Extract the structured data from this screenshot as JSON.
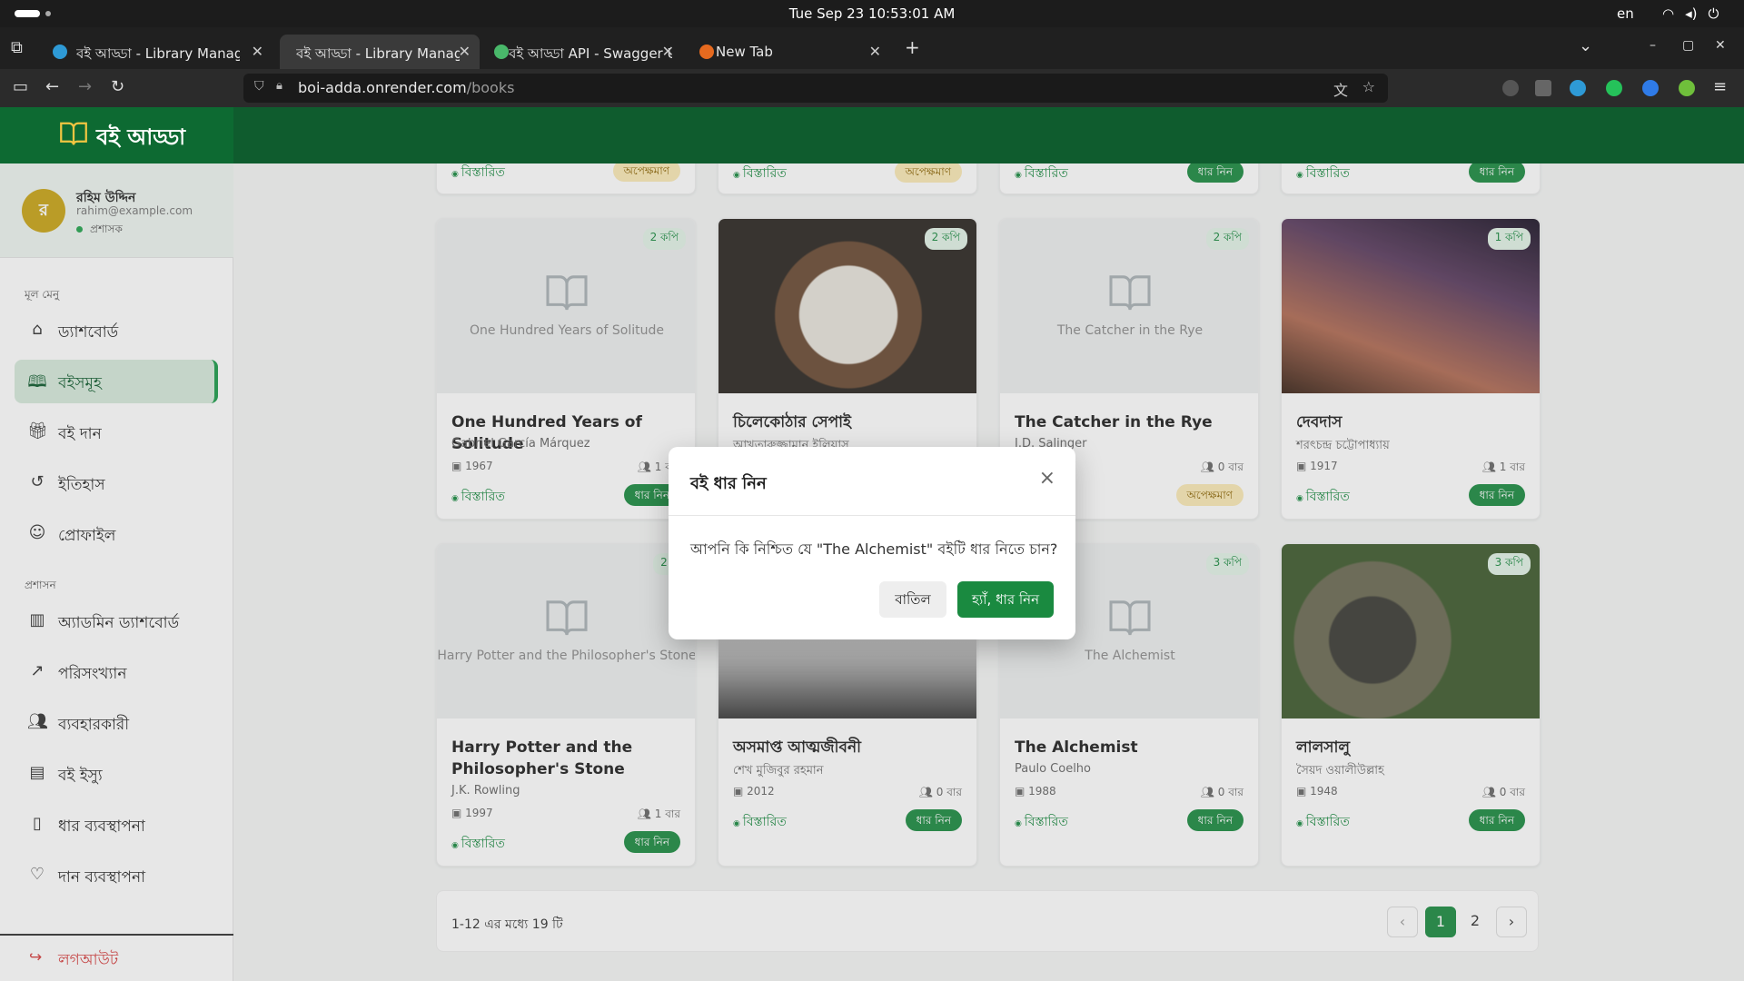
{
  "system": {
    "datetime": "Tue Sep 23  10:53:01 AM",
    "lang": "en"
  },
  "browser": {
    "tabs": [
      {
        "label": "বই আড্ডা - Library Manageme"
      },
      {
        "label": "বই আড্ডা - Library Manageme"
      },
      {
        "label": "বই আড্ডা API - Swagger UI"
      },
      {
        "label": "New Tab"
      }
    ],
    "url_host": "boi-adda.onrender.com",
    "url_path": "/books"
  },
  "app": {
    "brand": "বই আড্ডা"
  },
  "user": {
    "initial": "র",
    "name": "রহিম উদ্দিন",
    "email": "rahim@example.com",
    "role": "প্রশাসক"
  },
  "sidebar": {
    "main_section": "মূল মেনু",
    "admin_section": "প্রশাসন",
    "main_items": [
      {
        "label": "ড্যাশবোর্ড",
        "icon": "home-icon"
      },
      {
        "label": "বইসমূহ",
        "icon": "book-icon"
      },
      {
        "label": "বই দান",
        "icon": "gift-icon"
      },
      {
        "label": "ইতিহাস",
        "icon": "history-icon"
      },
      {
        "label": "প্রোফাইল",
        "icon": "user-icon"
      }
    ],
    "admin_items": [
      {
        "label": "অ্যাডমিন ড্যাশবোর্ড",
        "icon": "bar-chart-icon"
      },
      {
        "label": "পরিসংখ্যান",
        "icon": "trend-icon"
      },
      {
        "label": "ব্যবহারকারী",
        "icon": "users-icon"
      },
      {
        "label": "বই ইস্যু",
        "icon": "issue-icon"
      },
      {
        "label": "ধার ব্যবস্থাপনা",
        "icon": "borrow-icon"
      },
      {
        "label": "দান ব্যবস্থাপনা",
        "icon": "heart-icon"
      }
    ],
    "logout": "লগআউট"
  },
  "top_row": {
    "detail": "বিস্তারিত",
    "statuses": [
      "অপেক্ষমাণ",
      "অপেক্ষমাণ",
      "ধার নিন",
      "ধার নিন"
    ]
  },
  "books": [
    {
      "title": "One Hundred Years of Solitude",
      "cover_title": "One Hundred Years of Solitude",
      "author": "Gabriel García Márquez",
      "year": "1967",
      "borrows": "1 বার",
      "copies": "2 কপি",
      "action": "ধার নিন",
      "detail": "বিস্তারিত"
    },
    {
      "title": "চিলেকোঠার সেপাই",
      "cover_title": "",
      "author": "আখতারুজ্জামান ইলিয়াস",
      "year": "",
      "borrows": "",
      "copies": "2 কপি",
      "action": "",
      "detail": ""
    },
    {
      "title": "The Catcher in the Rye",
      "cover_title": "The Catcher in the Rye",
      "author": "J.D. Salinger",
      "year": "",
      "borrows": "0 বার",
      "copies": "2 কপি",
      "action": "অপেক্ষমাণ",
      "detail": ""
    },
    {
      "title": "দেবদাস",
      "cover_title": "",
      "author": "শরৎচন্দ্র চট্টোপাধ্যায়",
      "year": "1917",
      "borrows": "1 বার",
      "copies": "1 কপি",
      "action": "ধার নিন",
      "detail": "বিস্তারিত"
    },
    {
      "title": "Harry Potter and the Philosopher's Stone",
      "cover_title": "Harry Potter and the Philosopher's Stone",
      "author": "J.K. Rowling",
      "year": "1997",
      "borrows": "1 বার",
      "copies": "2 ক",
      "action": "ধার নিন",
      "detail": "বিস্তারিত"
    },
    {
      "title": "অসমাপ্ত আত্মজীবনী",
      "cover_title": "",
      "author": "শেখ মুজিবুর রহমান",
      "year": "2012",
      "borrows": "0 বার",
      "copies": "",
      "action": "ধার নিন",
      "detail": "বিস্তারিত"
    },
    {
      "title": "The Alchemist",
      "cover_title": "The Alchemist",
      "author": "Paulo Coelho",
      "year": "1988",
      "borrows": "0 বার",
      "copies": "3 কপি",
      "action": "ধার নিন",
      "detail": "বিস্তারিত"
    },
    {
      "title": "লালসালু",
      "cover_title": "",
      "author": "সৈয়দ ওয়ালীউল্লাহ",
      "year": "1948",
      "borrows": "0 বার",
      "copies": "3 কপি",
      "action": "ধার নিন",
      "detail": "বিস্তারিত"
    }
  ],
  "pagination": {
    "info": "1-12 এর মধ্যে 19 টি",
    "prev": "‹",
    "pages": [
      "1",
      "2"
    ],
    "next": "›"
  },
  "modal": {
    "title": "বই ধার নিন",
    "close": "×",
    "message": "আপনি কি নিশ্চিত যে \"The Alchemist\" বইটি ধার নিতে চান?",
    "cancel": "বাতিল",
    "confirm": "হ্যাঁ, ধার নিন"
  },
  "colors": {
    "primary": "#1a8a40",
    "header": "#0f5c2e",
    "pending": "#fbe9b5",
    "avatar": "#c9a415",
    "logout": "#d63c3c"
  }
}
